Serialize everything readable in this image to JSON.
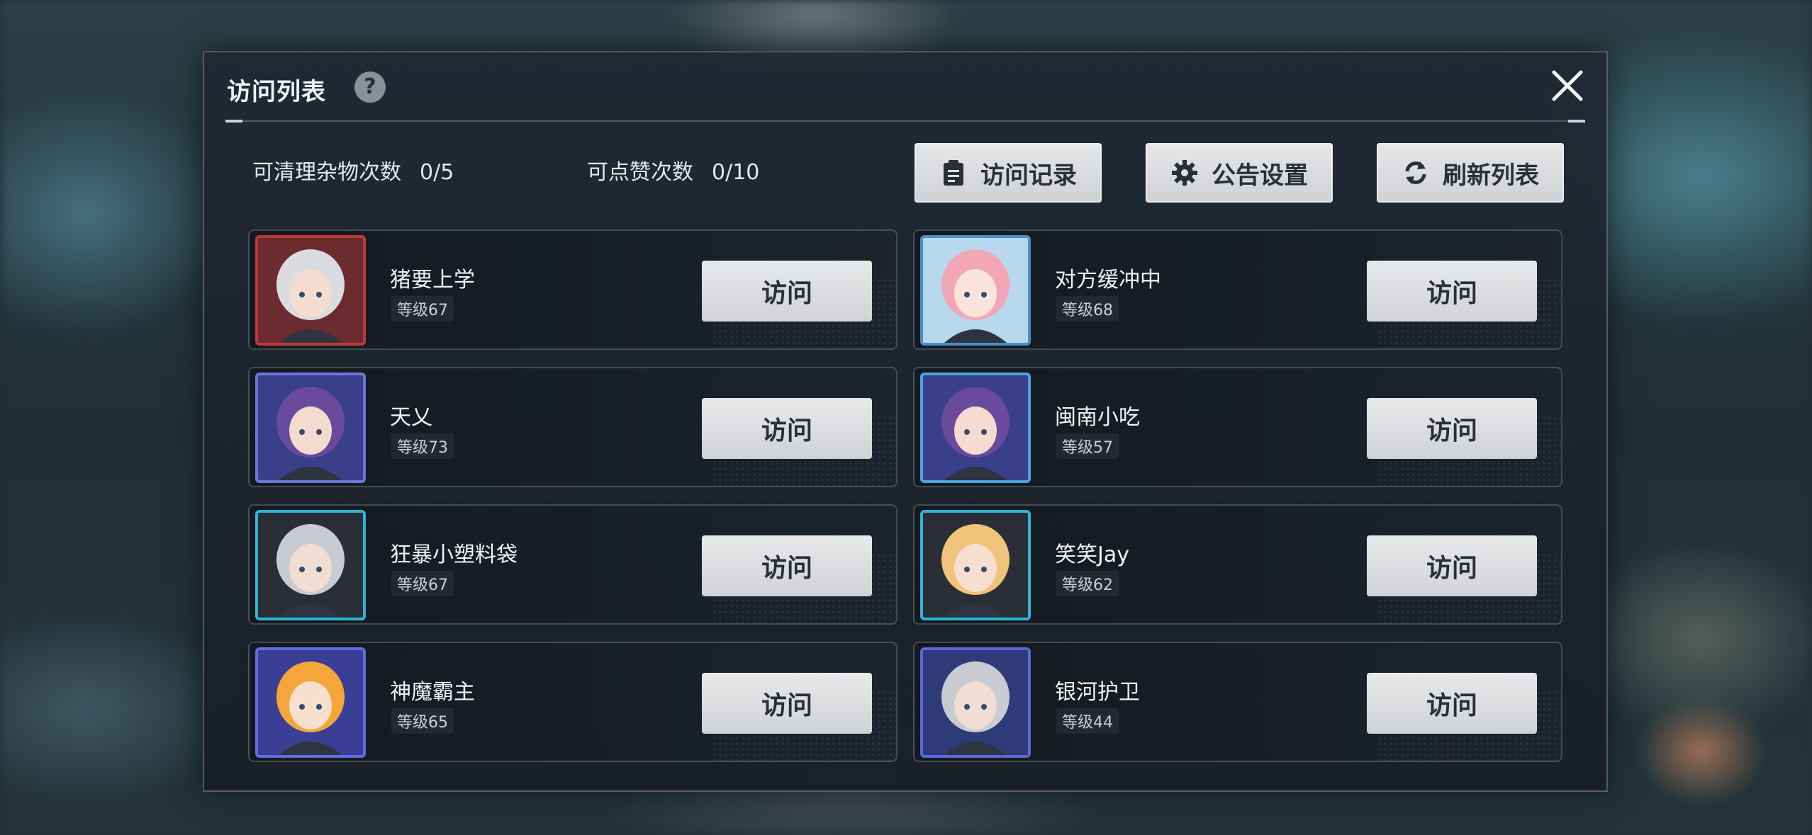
{
  "dialog": {
    "title": "访问列表",
    "help_icon": "question-circle-icon",
    "close_icon": "close-x-icon"
  },
  "stats": {
    "clean_label": "可清理杂物次数",
    "clean_value": "0/5",
    "like_label": "可点赞次数",
    "like_value": "0/10"
  },
  "buttons": {
    "visit_record": "访问记录",
    "notice_settings": "公告设置",
    "refresh_list": "刷新列表"
  },
  "players": [
    {
      "name": "猪要上学",
      "level": "等级67",
      "visit": "访问",
      "frame_color": "#c0393a",
      "hair": "#d9dbdf",
      "skin": "#f4ddd0",
      "bg": "#6c2b2f"
    },
    {
      "name": "对方缓冲中",
      "level": "等级68",
      "visit": "访问",
      "frame_color": "#4a8ec9",
      "hair": "#f2a7b8",
      "skin": "#fbe4da",
      "bg": "#b8d8ee"
    },
    {
      "name": "天乂",
      "level": "等级73",
      "visit": "访问",
      "frame_color": "#6b76d8",
      "hair": "#6a4a9a",
      "skin": "#f3dccf",
      "bg": "#3a3f8a"
    },
    {
      "name": "闽南小吃",
      "level": "等级57",
      "visit": "访问",
      "frame_color": "#4aa4e0",
      "hair": "#6a4a9a",
      "skin": "#f3dccf",
      "bg": "#3a3f8a"
    },
    {
      "name": "狂暴小塑料袋",
      "level": "等级67",
      "visit": "访问",
      "frame_color": "#2fb4d8",
      "hair": "#c8ccd2",
      "skin": "#f1ddd2",
      "bg": "#2a2e36"
    },
    {
      "name": "笑笑Jay",
      "level": "等级62",
      "visit": "访问",
      "frame_color": "#2fb4d8",
      "hair": "#f0c27a",
      "skin": "#f7dfd0",
      "bg": "#2a2e36"
    },
    {
      "name": "神魔霸主",
      "level": "等级65",
      "visit": "访问",
      "frame_color": "#5f6fe0",
      "hair": "#f4a63a",
      "skin": "#f8e0cf",
      "bg": "#3b3e95"
    },
    {
      "name": "银河护卫",
      "level": "等级44",
      "visit": "访问",
      "frame_color": "#5a6ad8",
      "hair": "#c8ccd2",
      "skin": "#f1ddd2",
      "bg": "#2f3a78"
    }
  ]
}
